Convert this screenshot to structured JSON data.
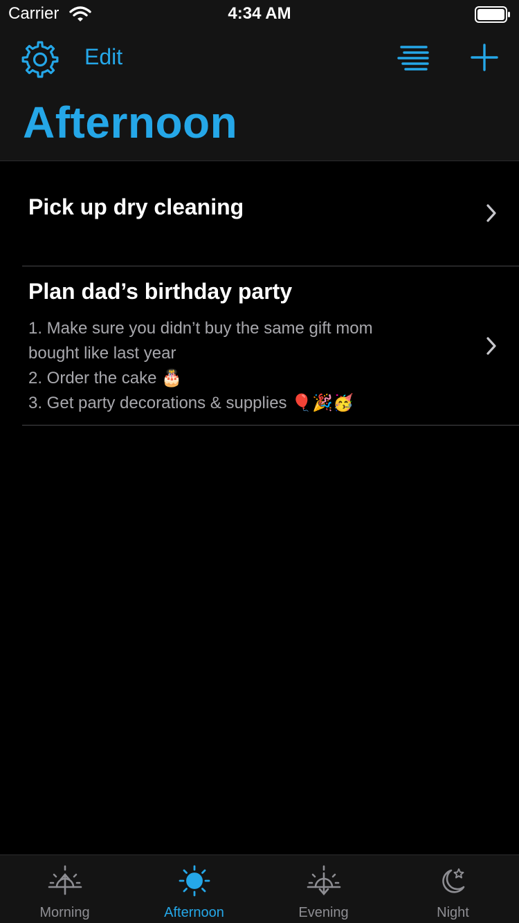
{
  "status_bar": {
    "carrier": "Carrier",
    "time": "4:34 AM"
  },
  "nav": {
    "settings_icon": "gear-icon",
    "edit_label": "Edit",
    "sort_icon": "list-sort-icon",
    "add_icon": "plus-icon",
    "title": "Afternoon"
  },
  "tasks": [
    {
      "title": "Pick up dry cleaning",
      "notes": []
    },
    {
      "title": "Plan dad’s birthday party",
      "notes": [
        "1. Make sure you didn’t buy the same gift mom",
        "bought like last year",
        "2. Order the cake 🎂",
        "3. Get party decorations & supplies 🎈🎉🥳"
      ]
    }
  ],
  "tabs": [
    {
      "label": "Morning",
      "icon": "sunrise-icon",
      "active": false
    },
    {
      "label": "Afternoon",
      "icon": "sun-icon",
      "active": true
    },
    {
      "label": "Evening",
      "icon": "sunset-icon",
      "active": false
    },
    {
      "label": "Night",
      "icon": "moon-star-icon",
      "active": false
    }
  ],
  "colors": {
    "accent": "#25a7e8",
    "background": "#000000",
    "bar_background": "#141414",
    "inactive": "#8e8e93",
    "notes_text": "#a8a8ad"
  }
}
